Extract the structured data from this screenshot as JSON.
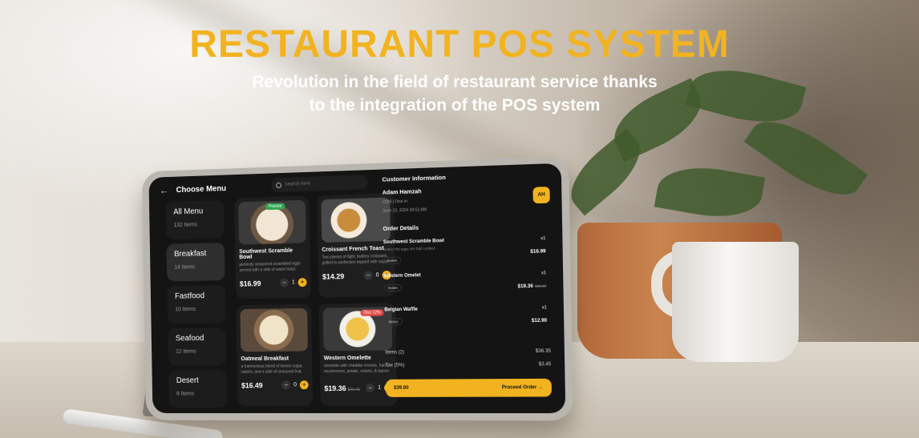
{
  "hero": {
    "title": "RESTAURANT POS SYSTEM",
    "subtitle_line1": "Revolution in the field of restaurant service thanks",
    "subtitle_line2": "to the integration of the POS system"
  },
  "colors": {
    "accent": "#f2b320",
    "screen_bg": "#141414",
    "card_bg": "#1e1e1e"
  },
  "app": {
    "title": "Choose Menu",
    "search_placeholder": "Search here",
    "categories": [
      {
        "name": "All Menu",
        "count": "132 Items"
      },
      {
        "name": "Breakfast",
        "count": "14 Items",
        "active": true
      },
      {
        "name": "Fastfood",
        "count": "10 Items"
      },
      {
        "name": "Seafood",
        "count": "12 Items"
      },
      {
        "name": "Desert",
        "count": "8 Items"
      }
    ],
    "menu": [
      {
        "name": "Southwest Scramble Bowl",
        "desc": "perfectly seasoned scrambled eggs served with a side of warm toast.",
        "price": "$16.99",
        "qty": "1",
        "badge": "Popular"
      },
      {
        "name": "Croissant French Toast",
        "desc": "Two pieces of light, buttery croissant, grilled to perfection topped with sugar",
        "price": "$14.29",
        "qty": "0"
      },
      {
        "name": "Oatmeal Breakfast",
        "desc": "a harmonious blend of brown sugar, raisins, and a side of seasonal fruit.",
        "price": "$16.49",
        "qty": "0"
      },
      {
        "name": "Western Omelette",
        "desc": "omelette with cheddar cheese, ham, mushrooms, potato, onions, & bacon",
        "price": "$19.36",
        "old_price": "$22.49",
        "qty": "1",
        "badge": "Disc 12%"
      }
    ],
    "customer": {
      "title": "Customer Information",
      "name": "Adam Hamzah",
      "meta1": "#289 | Dine in",
      "meta2": "June 10, 2024 09:52 AM",
      "avatar": "AH"
    },
    "order": {
      "title": "Order Details",
      "items": [
        {
          "name": "Southwest Scramble Bowl",
          "note": "Notes: the eggs are half cooked",
          "qty": "x1",
          "price": "$16.99",
          "notes_label": "Notes"
        },
        {
          "name": "Western Omelet",
          "note": "",
          "qty": "x1",
          "price": "$19.36",
          "old_price": "$22.49",
          "notes_label": "Notes"
        },
        {
          "name": "Belgian Waffle",
          "note": "",
          "qty": "x1",
          "price": "$12.90",
          "notes_label": "Notes"
        }
      ],
      "items_label": "Items (2)",
      "items_total": "$36.35",
      "tax_label": "Tax (5%)",
      "tax_value": "$3.45",
      "grand_total": "$39.80",
      "proceed_label": "Proceed Order"
    }
  }
}
